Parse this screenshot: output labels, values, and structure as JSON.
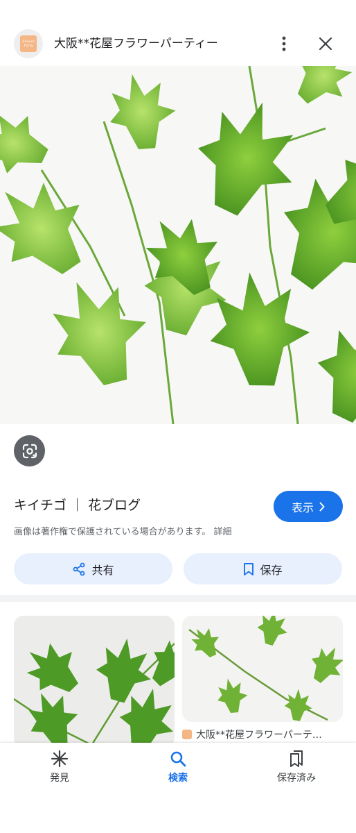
{
  "header": {
    "site_name": "大阪**花屋フラワーパーティー",
    "logo_text_line1": "Flower",
    "logo_text_line2": "Party",
    "more_icon": "more-vert-icon",
    "close_icon": "close-icon"
  },
  "result": {
    "title": "キイチゴ ｜ 花ブログ",
    "visit_label": "表示",
    "copyright_notice": "画像は著作権で保護されている場合があります。 詳細"
  },
  "actions": {
    "share_label": "共有",
    "save_label": "保存"
  },
  "related": {
    "thumb2_source": "大阪**花屋フラワーパーテ…"
  },
  "bottom_nav": {
    "items": [
      {
        "label": "発見",
        "icon": "asterisk-icon"
      },
      {
        "label": "検索",
        "icon": "search-icon"
      },
      {
        "label": "保存済み",
        "icon": "collections-icon"
      }
    ]
  },
  "colors": {
    "accent": "#1a73e8",
    "pill_bg": "#e8f0fe",
    "lens_bg": "#5f6368",
    "leaf_light": "#9fd64a",
    "leaf_dark": "#4f9a22"
  }
}
